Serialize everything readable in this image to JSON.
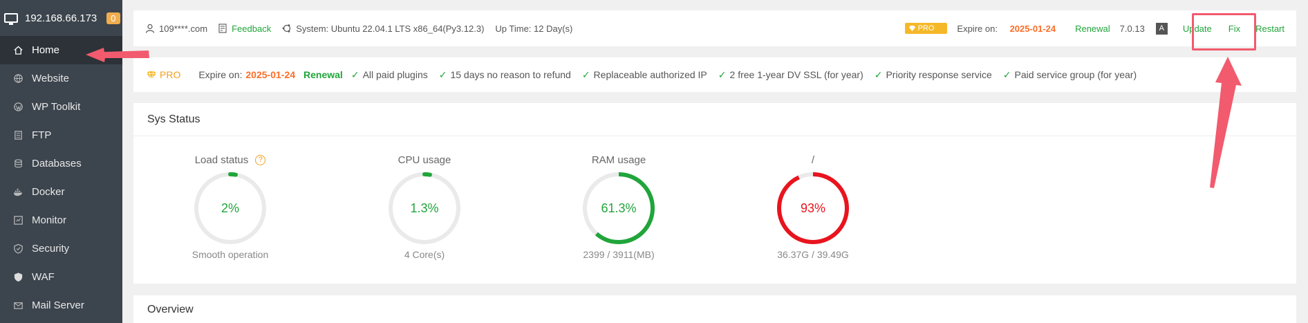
{
  "sidebar": {
    "ip": "192.168.66.173",
    "badge": "0",
    "items": [
      {
        "label": "Home",
        "icon": "home-icon"
      },
      {
        "label": "Website",
        "icon": "globe-icon"
      },
      {
        "label": "WP Toolkit",
        "icon": "wordpress-icon"
      },
      {
        "label": "FTP",
        "icon": "ftp-icon"
      },
      {
        "label": "Databases",
        "icon": "database-icon"
      },
      {
        "label": "Docker",
        "icon": "docker-icon"
      },
      {
        "label": "Monitor",
        "icon": "monitor-icon"
      },
      {
        "label": "Security",
        "icon": "shield-icon"
      },
      {
        "label": "WAF",
        "icon": "waf-icon"
      },
      {
        "label": "Mail Server",
        "icon": "mail-icon"
      }
    ]
  },
  "topbar": {
    "user": "109****.com",
    "feedback": "Feedback",
    "system": "System: Ubuntu 22.04.1 LTS x86_64(Py3.12.3)",
    "uptime": "Up Time: 12 Day(s)",
    "pro_badge": "PRO",
    "expire_label": "Expire on:",
    "expire_date": "2025-01-24",
    "renewal": "Renewal",
    "version": "7.0.13",
    "update": "Update",
    "fix": "Fix",
    "restart": "Restart"
  },
  "probar": {
    "pro": "PRO",
    "expire_label": "Expire on:",
    "expire_date": "2025-01-24",
    "renewal": "Renewal",
    "features": [
      "All paid plugins",
      "15 days no reason to refund",
      "Replaceable authorized IP",
      "2 free 1-year DV SSL (for year)",
      "Priority response service",
      "Paid service group (for year)"
    ]
  },
  "sys_status": {
    "title": "Sys Status",
    "gauges": [
      {
        "label": "Load status",
        "value": "2%",
        "percent": 2,
        "sub": "Smooth operation",
        "color": "#20a53a"
      },
      {
        "label": "CPU usage",
        "value": "1.3%",
        "percent": 1.3,
        "sub": "4 Core(s)",
        "color": "#20a53a"
      },
      {
        "label": "RAM usage",
        "value": "61.3%",
        "percent": 61.3,
        "sub": "2399 / 3911(MB)",
        "color": "#20a53a"
      },
      {
        "label": "/",
        "value": "93%",
        "percent": 93,
        "sub": "36.37G / 39.49G",
        "color": "#e8141e"
      }
    ]
  },
  "overview": {
    "title": "Overview"
  },
  "colors": {
    "accent": "#20a53a",
    "danger": "#e8141e",
    "annotation": "#f25a6e",
    "sidebar": "#3c444d"
  }
}
